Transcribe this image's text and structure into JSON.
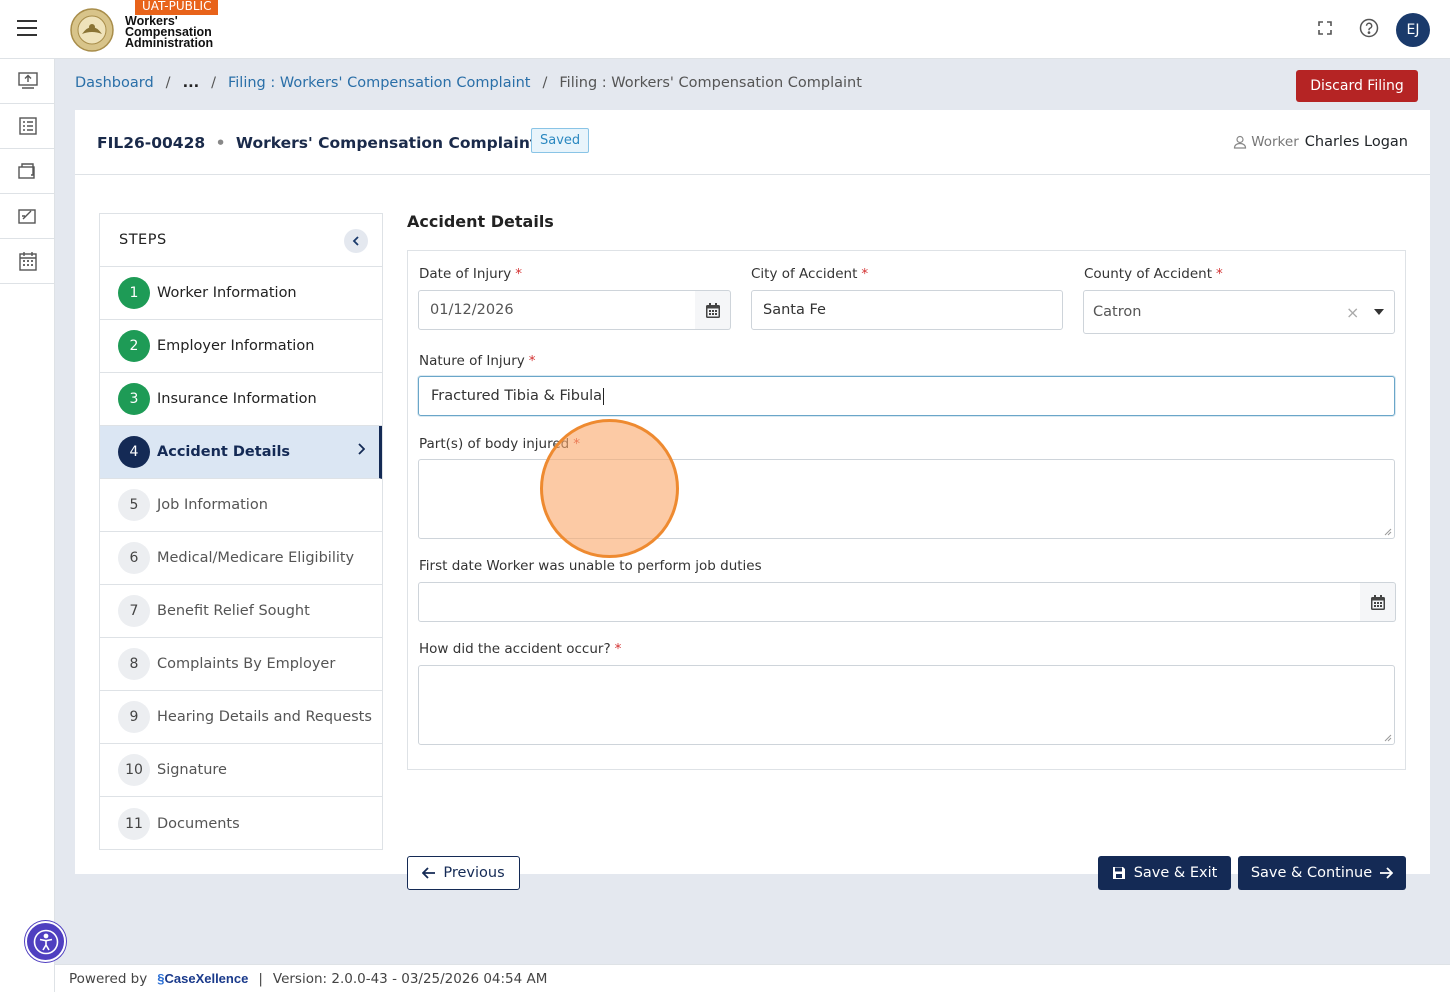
{
  "header": {
    "env_badge": "UAT-PUBLIC",
    "org_name_line1": "Workers'",
    "org_name_line2": "Compensation",
    "org_name_line3": "Administration",
    "avatar_initials": "EJ"
  },
  "breadcrumb": {
    "items": [
      "Dashboard",
      "...",
      "Filing : Workers' Compensation Complaint",
      "Filing : Workers' Compensation Complaint"
    ]
  },
  "actions": {
    "discard_label": "Discard Filing"
  },
  "filing": {
    "id": "FIL26-00428",
    "title": "Workers' Compensation Complaint",
    "status": "Saved",
    "worker_label": "Worker",
    "worker_name": "Charles Logan"
  },
  "steps": {
    "heading": "STEPS",
    "items": [
      {
        "num": "1",
        "label": "Worker Information",
        "state": "done"
      },
      {
        "num": "2",
        "label": "Employer Information",
        "state": "done"
      },
      {
        "num": "3",
        "label": "Insurance Information",
        "state": "done"
      },
      {
        "num": "4",
        "label": "Accident Details",
        "state": "active"
      },
      {
        "num": "5",
        "label": "Job Information",
        "state": "todo"
      },
      {
        "num": "6",
        "label": "Medical/Medicare Eligibility",
        "state": "todo"
      },
      {
        "num": "7",
        "label": "Benefit Relief Sought",
        "state": "todo"
      },
      {
        "num": "8",
        "label": "Complaints By Employer",
        "state": "todo"
      },
      {
        "num": "9",
        "label": "Hearing Details and Requests",
        "state": "todo"
      },
      {
        "num": "10",
        "label": "Signature",
        "state": "todo"
      },
      {
        "num": "11",
        "label": "Documents",
        "state": "todo"
      }
    ]
  },
  "form": {
    "title": "Accident Details",
    "date_of_injury": {
      "label": "Date of Injury",
      "value": "01/12/2026"
    },
    "city": {
      "label": "City of Accident",
      "value": "Santa Fe"
    },
    "county": {
      "label": "County of Accident",
      "value": "Catron",
      "clear": "×"
    },
    "nature": {
      "label": "Nature of Injury",
      "value": "Fractured Tibia & Fibula"
    },
    "body_parts": {
      "label": "Part(s) of body injured",
      "value": ""
    },
    "first_date": {
      "label": "First date Worker was unable to perform job duties",
      "value": ""
    },
    "how": {
      "label": "How did the accident occur?",
      "value": ""
    },
    "required_mark": "*"
  },
  "buttons": {
    "previous": "Previous",
    "save_exit": "Save & Exit",
    "save_continue": "Save & Continue"
  },
  "footer": {
    "powered_by": "Powered by",
    "brand": "CaseXellence",
    "separator": "|",
    "version": "Version: 2.0.0-43 - 03/25/2026 04:54 AM"
  },
  "colors": {
    "primary": "#142a55",
    "danger": "#b52424",
    "success": "#1e9b56",
    "badge": "#e8631a",
    "background": "#e4e8ef"
  }
}
